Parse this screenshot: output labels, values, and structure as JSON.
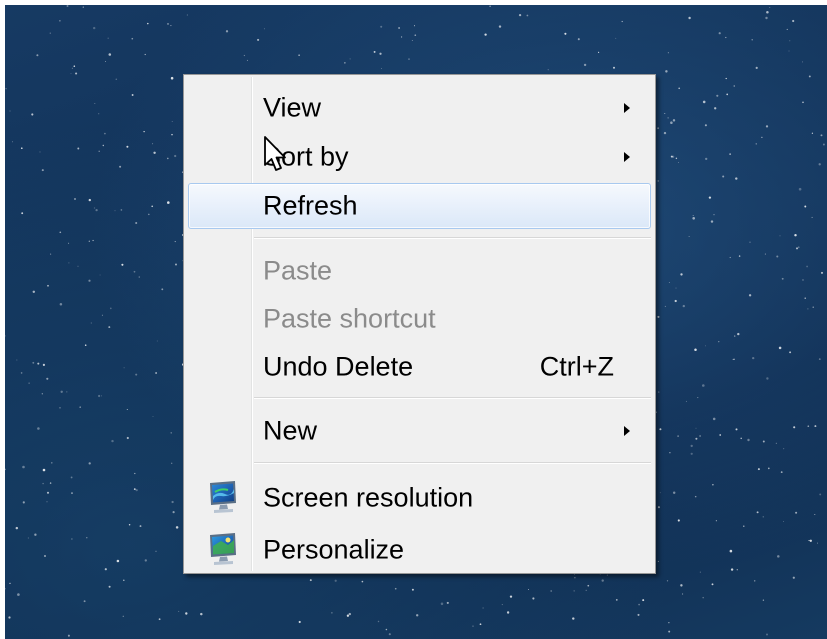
{
  "context_menu": {
    "items": [
      {
        "label": "View",
        "has_submenu": true
      },
      {
        "label": "Sort by",
        "has_submenu": true
      },
      {
        "label": "Refresh",
        "state": "hovered"
      },
      {
        "label": "Paste",
        "state": "disabled"
      },
      {
        "label": "Paste shortcut",
        "state": "disabled"
      },
      {
        "label": "Undo Delete",
        "shortcut": "Ctrl+Z"
      },
      {
        "label": "New",
        "has_submenu": true
      },
      {
        "label": "Screen resolution",
        "icon": "screen-resolution-icon"
      },
      {
        "label": "Personalize",
        "icon": "personalize-icon"
      }
    ]
  },
  "colors": {
    "desktop_background": "#13355a",
    "menu_background": "#f0f0f0",
    "hover_border": "#a8c9ef",
    "disabled_text": "#8b8b8b"
  }
}
